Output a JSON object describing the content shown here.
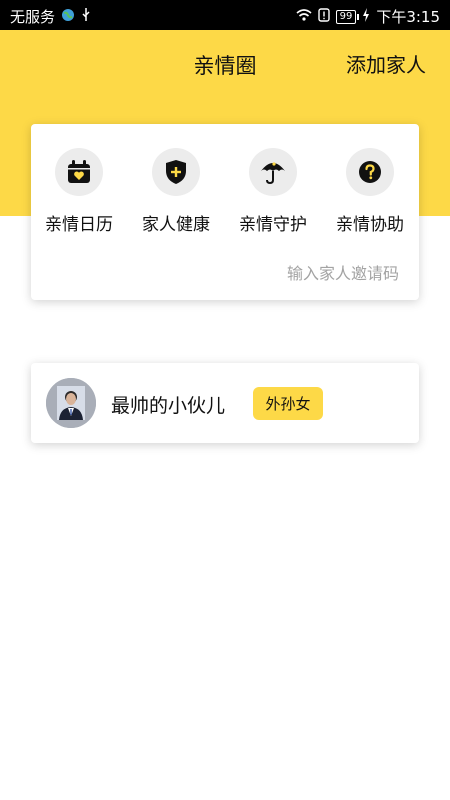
{
  "status_bar": {
    "carrier": "无服务",
    "battery": "99",
    "time": "下午3:15"
  },
  "header": {
    "title": "亲情圈",
    "add_member": "添加家人"
  },
  "menu": [
    {
      "label": "亲情日历",
      "icon": "calendar-heart-icon"
    },
    {
      "label": "家人健康",
      "icon": "shield-plus-icon"
    },
    {
      "label": "亲情守护",
      "icon": "umbrella-icon"
    },
    {
      "label": "亲情协助",
      "icon": "help-icon"
    }
  ],
  "invite": {
    "text": "输入家人邀请码"
  },
  "members": [
    {
      "name": "最帅的小伙儿",
      "relation": "外孙女"
    }
  ],
  "colors": {
    "accent": "#fdd947",
    "icon_bg": "#ececec",
    "muted_text": "#a3a3a3"
  }
}
